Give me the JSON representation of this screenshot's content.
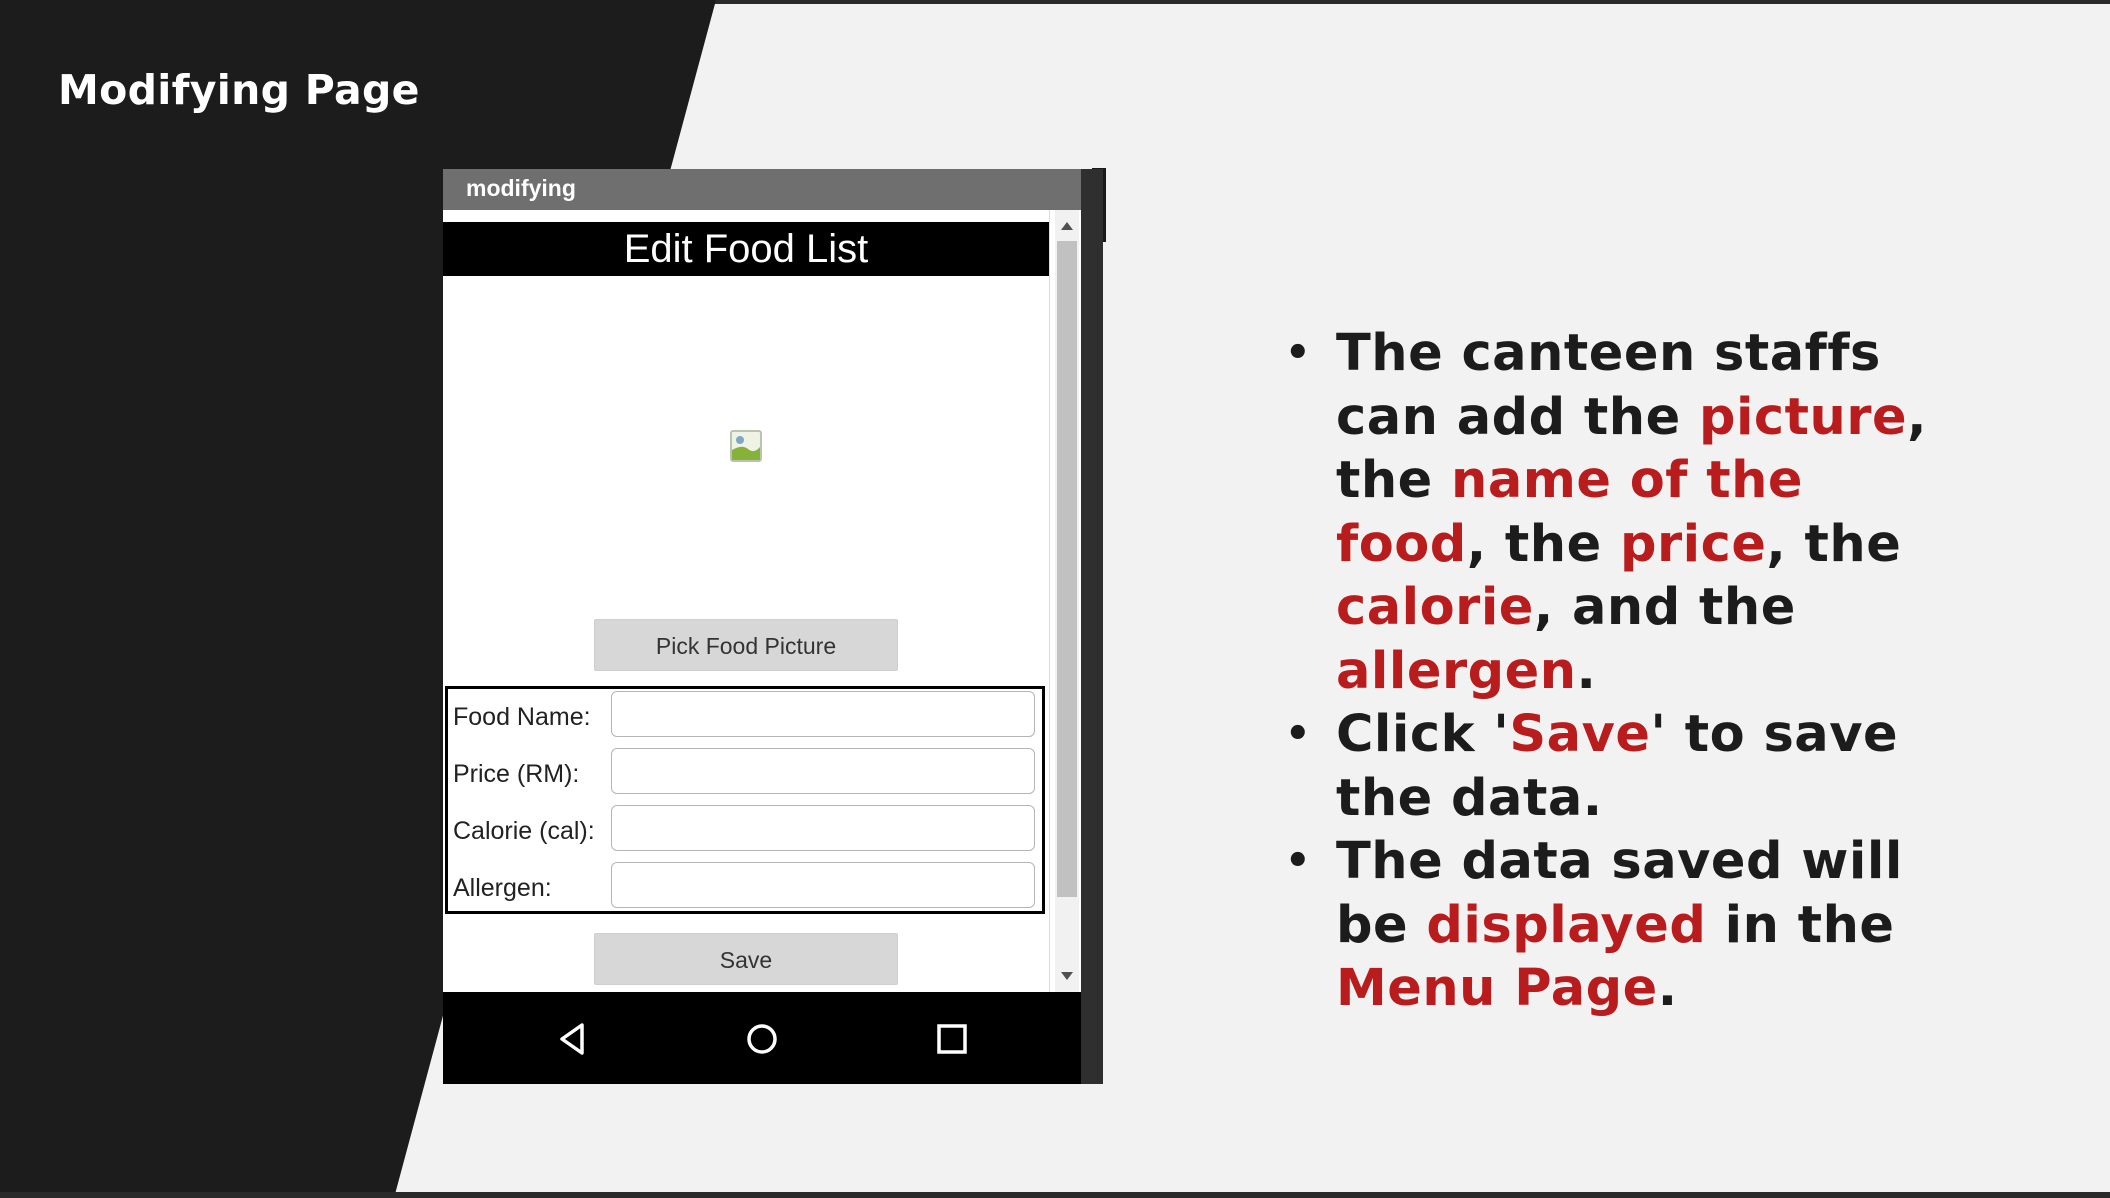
{
  "slide": {
    "title": "Modifying Page"
  },
  "phone": {
    "app_bar_title": "modifying",
    "screen_title": "Edit Food List",
    "image_placeholder_icon": "broken-image-icon",
    "pick_button_label": "Pick Food Picture",
    "form": {
      "fields": [
        {
          "label": "Food Name:",
          "value": ""
        },
        {
          "label": "Price (RM):",
          "value": ""
        },
        {
          "label": "Calorie (cal):",
          "value": ""
        },
        {
          "label": "Allergen:",
          "value": ""
        }
      ]
    },
    "save_button_label": "Save",
    "nav_icons": [
      "back-triangle-icon",
      "home-circle-icon",
      "recents-square-icon"
    ]
  },
  "bullets": [
    {
      "parts": [
        {
          "text": "The canteen staffs can add the ",
          "highlight": false
        },
        {
          "text": "picture",
          "highlight": true
        },
        {
          "text": ", the ",
          "highlight": false
        },
        {
          "text": "name of the food",
          "highlight": true
        },
        {
          "text": ", the ",
          "highlight": false
        },
        {
          "text": "price",
          "highlight": true
        },
        {
          "text": ", the ",
          "highlight": false
        },
        {
          "text": "calorie",
          "highlight": true
        },
        {
          "text": ", and the ",
          "highlight": false
        },
        {
          "text": "allergen",
          "highlight": true
        },
        {
          "text": ".",
          "highlight": false
        }
      ]
    },
    {
      "parts": [
        {
          "text": "Click '",
          "highlight": false
        },
        {
          "text": "Save",
          "highlight": true
        },
        {
          "text": "' to save the data.",
          "highlight": false
        }
      ]
    },
    {
      "parts": [
        {
          "text": "The data saved will be ",
          "highlight": false
        },
        {
          "text": "displayed",
          "highlight": true
        },
        {
          "text": " in the ",
          "highlight": false
        },
        {
          "text": "Menu Page",
          "highlight": true
        },
        {
          "text": ".",
          "highlight": false
        }
      ]
    }
  ],
  "bullet_symbol": "•",
  "colors": {
    "dark_panel": "#1c1c1c",
    "background": "#f2f2f2",
    "highlight": "#b91c1c",
    "body_text": "#1c1c1c"
  }
}
